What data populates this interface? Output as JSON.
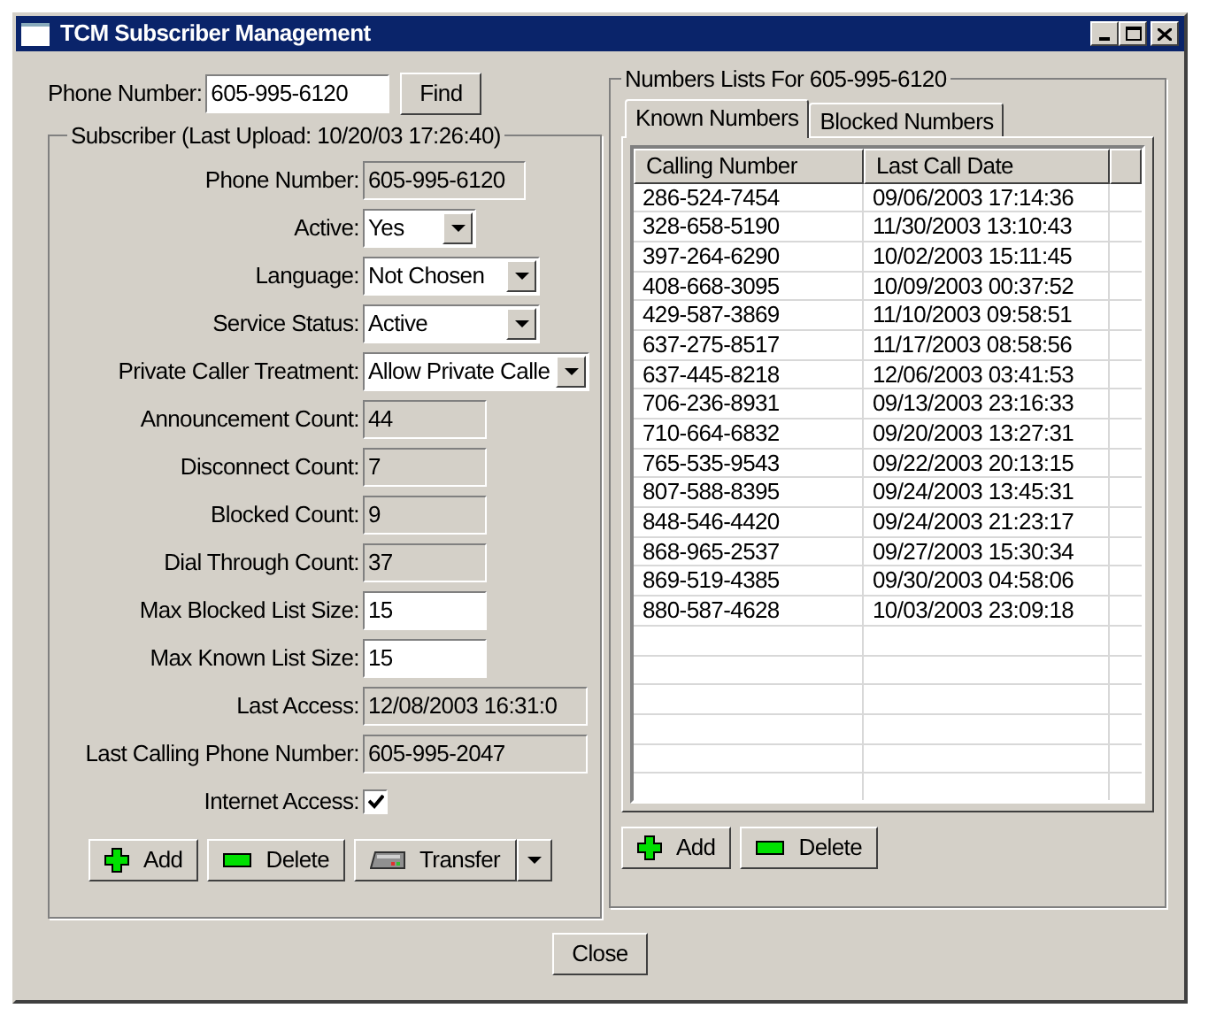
{
  "window": {
    "title": "TCM Subscriber Management"
  },
  "lookup": {
    "label": "Phone Number:",
    "value": "605-995-6120",
    "button": "Find"
  },
  "subscriber": {
    "legend": "Subscriber (Last Upload: 10/20/03 17:26:40)",
    "fields": [
      {
        "label": "Phone Number:",
        "kind": "readonly",
        "value": "605-995-6120"
      },
      {
        "label": "Active:",
        "kind": "combo",
        "value": "Yes"
      },
      {
        "label": "Language:",
        "kind": "combo",
        "value": "Not Chosen"
      },
      {
        "label": "Service Status:",
        "kind": "combo",
        "value": "Active"
      },
      {
        "label": "Private Caller Treatment:",
        "kind": "combo",
        "value": "Allow Private Calle"
      },
      {
        "label": "Announcement Count:",
        "kind": "readonly",
        "value": "44"
      },
      {
        "label": "Disconnect Count:",
        "kind": "readonly",
        "value": "7"
      },
      {
        "label": "Blocked Count:",
        "kind": "readonly",
        "value": "9"
      },
      {
        "label": "Dial Through Count:",
        "kind": "readonly",
        "value": "37"
      },
      {
        "label": "Max Blocked List Size:",
        "kind": "text",
        "value": "15"
      },
      {
        "label": "Max Known List Size:",
        "kind": "text",
        "value": "15"
      },
      {
        "label": "Last Access:",
        "kind": "readonly",
        "value": "12/08/2003 16:31:0"
      },
      {
        "label": "Last Calling Phone Number:",
        "kind": "readonly",
        "value": "605-995-2047"
      },
      {
        "label": "Internet Access:",
        "kind": "checkbox",
        "checked": true
      }
    ],
    "buttons": [
      {
        "label": "Add",
        "kind": "add"
      },
      {
        "label": "Delete",
        "kind": "delete"
      },
      {
        "label": "Transfer",
        "kind": "transfer"
      }
    ]
  },
  "numbers": {
    "legend": "Numbers Lists For 605-995-6120",
    "tabs": [
      {
        "label": "Known Numbers",
        "selected": true
      },
      {
        "label": "Blocked Numbers",
        "selected": false
      }
    ],
    "columns": [
      "Calling Number",
      "Last Call Date"
    ],
    "rows": [
      [
        "286-524-7454",
        "09/06/2003 17:14:36"
      ],
      [
        "328-658-5190",
        "11/30/2003 13:10:43"
      ],
      [
        "397-264-6290",
        "10/02/2003 15:11:45"
      ],
      [
        "408-668-3095",
        "10/09/2003 00:37:52"
      ],
      [
        "429-587-3869",
        "11/10/2003 09:58:51"
      ],
      [
        "637-275-8517",
        "11/17/2003 08:58:56"
      ],
      [
        "637-445-8218",
        "12/06/2003 03:41:53"
      ],
      [
        "706-236-8931",
        "09/13/2003 23:16:33"
      ],
      [
        "710-664-6832",
        "09/20/2003 13:27:31"
      ],
      [
        "765-535-9543",
        "09/22/2003 20:13:15"
      ],
      [
        "807-588-8395",
        "09/24/2003 13:45:31"
      ],
      [
        "848-546-4420",
        "09/24/2003 21:23:17"
      ],
      [
        "868-965-2537",
        "09/27/2003 15:30:34"
      ],
      [
        "869-519-4385",
        "09/30/2003 04:58:06"
      ],
      [
        "880-587-4628",
        "10/03/2003 23:09:18"
      ]
    ],
    "buttons": [
      {
        "label": "Add",
        "kind": "add"
      },
      {
        "label": "Delete",
        "kind": "delete"
      }
    ]
  },
  "close_button": "Close"
}
